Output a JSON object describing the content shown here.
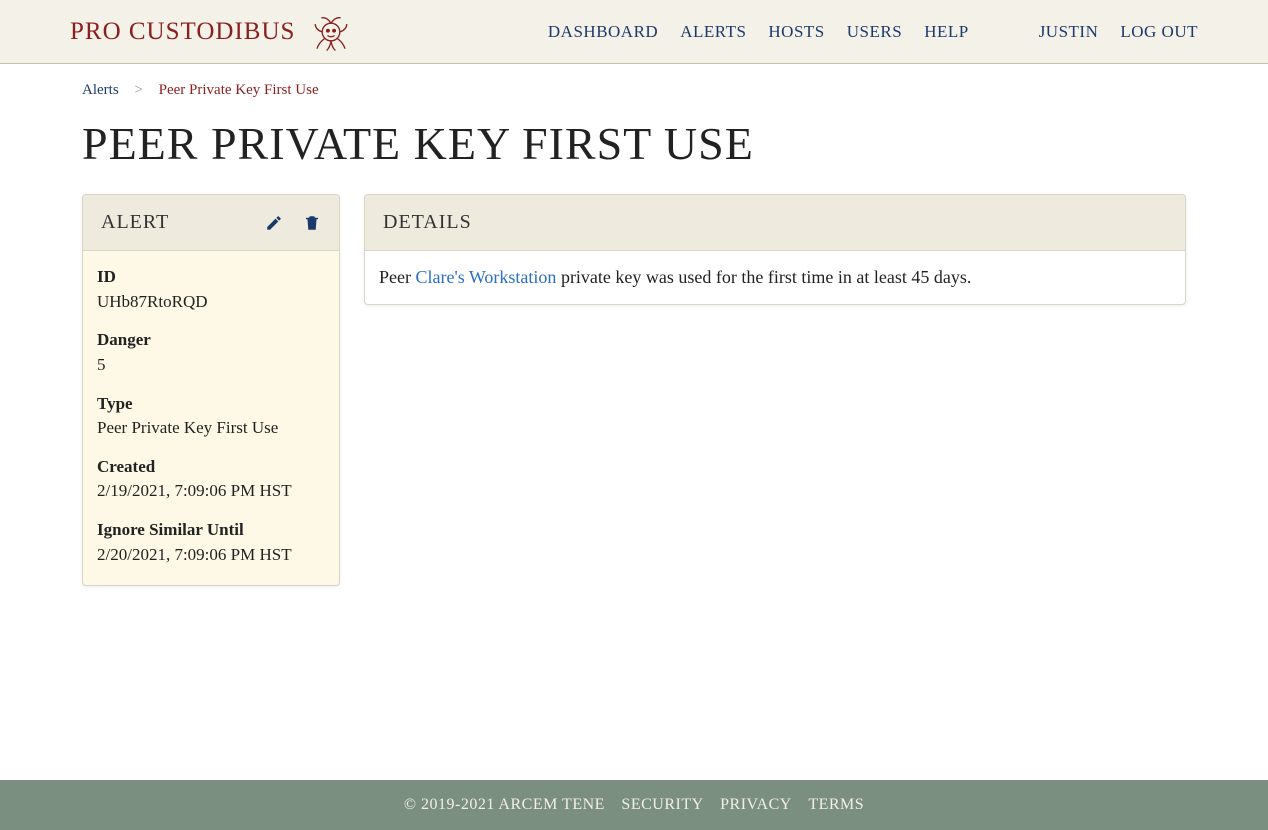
{
  "brand": {
    "name": "PRO CUSTODIBUS"
  },
  "nav": {
    "items": [
      "DASHBOARD",
      "ALERTS",
      "HOSTS",
      "USERS",
      "HELP"
    ],
    "user": "JUSTIN",
    "logout": "LOG OUT"
  },
  "breadcrumb": {
    "parent": "Alerts",
    "sep": ">",
    "current": "Peer Private Key First Use"
  },
  "page_title": "PEER PRIVATE KEY FIRST USE",
  "alert_card": {
    "title": "ALERT",
    "fields": {
      "id": {
        "label": "ID",
        "value": "UHb87RtoRQD"
      },
      "danger": {
        "label": "Danger",
        "value": "5"
      },
      "type": {
        "label": "Type",
        "value": "Peer Private Key First Use"
      },
      "created": {
        "label": "Created",
        "value": "2/19/2021, 7:09:06 PM HST"
      },
      "ignore": {
        "label": "Ignore Similar Until",
        "value": "2/20/2021, 7:09:06 PM HST"
      }
    }
  },
  "details_card": {
    "title": "DETAILS",
    "prefix": "Peer ",
    "link": "Clare's Workstation",
    "suffix": " private key was used for the first time in at least 45 days."
  },
  "footer": {
    "copyright": "© 2019-2021 ARCEM TENE",
    "links": [
      "SECURITY",
      "PRIVACY",
      "TERMS"
    ]
  }
}
